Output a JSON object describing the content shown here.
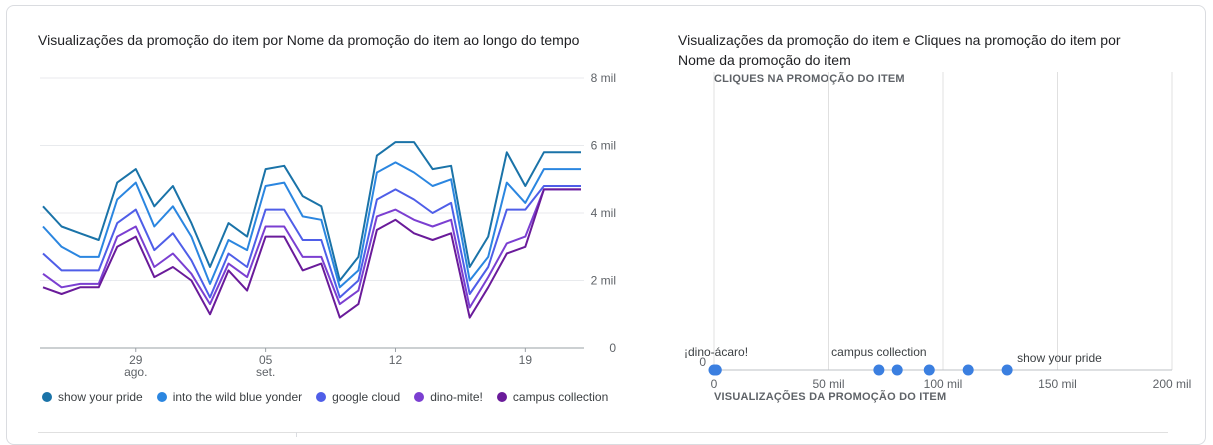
{
  "chart_data": [
    {
      "type": "line",
      "title": "Visualizações da promoção do item por Nome da promoção do item ao longo do tempo",
      "ylim": [
        0,
        8000
      ],
      "y_ticks": [
        "0",
        "2 mil",
        "4 mil",
        "6 mil",
        "8 mil"
      ],
      "y_tick_values": [
        0,
        2000,
        4000,
        6000,
        8000
      ],
      "x_tick_labels": [
        {
          "index": 5,
          "line1": "29",
          "line2": "ago."
        },
        {
          "index": 12,
          "line1": "05",
          "line2": "set."
        },
        {
          "index": 19,
          "line1": "12",
          "line2": ""
        },
        {
          "index": 26,
          "line1": "19",
          "line2": ""
        }
      ],
      "x_count": 30,
      "series": [
        {
          "name": "show your pride",
          "color": "#1a73a8",
          "values": [
            4200,
            3600,
            3400,
            3200,
            4900,
            5300,
            4200,
            4800,
            3700,
            2400,
            3700,
            3300,
            5300,
            5400,
            4500,
            4200,
            2000,
            2700,
            5700,
            6100,
            6100,
            5300,
            5400,
            2400,
            3300,
            5800,
            4800,
            5800,
            5800,
            5800
          ]
        },
        {
          "name": "into the wild blue yonder",
          "color": "#2b86e0",
          "values": [
            3600,
            3000,
            2700,
            2700,
            4400,
            4900,
            3600,
            4200,
            3300,
            1900,
            3200,
            2900,
            4800,
            4900,
            3900,
            3800,
            1800,
            2300,
            5200,
            5500,
            5200,
            4800,
            5000,
            2000,
            2700,
            4900,
            4300,
            5300,
            5300,
            5300
          ]
        },
        {
          "name": "google cloud",
          "color": "#4f5ee8",
          "values": [
            2800,
            2300,
            2300,
            2300,
            3700,
            4100,
            2900,
            3400,
            2600,
            1500,
            2800,
            2400,
            4100,
            4100,
            3200,
            3200,
            1500,
            2000,
            4400,
            4700,
            4400,
            4000,
            4300,
            1600,
            2400,
            4100,
            4100,
            4800,
            4800,
            4800
          ]
        },
        {
          "name": "dino-mite!",
          "color": "#7b3fd1",
          "values": [
            2200,
            1800,
            1900,
            1900,
            3300,
            3600,
            2400,
            2800,
            2200,
            1300,
            2500,
            2100,
            3600,
            3600,
            2700,
            2700,
            1300,
            1700,
            3900,
            4100,
            3800,
            3600,
            3800,
            1200,
            2100,
            3100,
            3300,
            4700,
            4700,
            4700
          ]
        },
        {
          "name": "campus collection",
          "color": "#6a1b9a",
          "values": [
            1800,
            1600,
            1800,
            1800,
            3000,
            3300,
            2100,
            2400,
            2000,
            1000,
            2300,
            1700,
            3300,
            3300,
            2300,
            2500,
            900,
            1300,
            3500,
            3800,
            3400,
            3200,
            3400,
            900,
            1800,
            2800,
            3000,
            4700,
            4700,
            4700
          ]
        }
      ]
    },
    {
      "type": "scatter",
      "title": "Visualizações da promoção do item e Cliques na promoção do item por Nome da promoção do item",
      "xlabel": "VISUALIZAÇÕES DA PROMOÇÃO DO ITEM",
      "ylabel": "CLIQUES NA PROMOÇÃO DO ITEM",
      "xlim": [
        0,
        200000
      ],
      "x_ticks": [
        "0",
        "50 mil",
        "100 mil",
        "150 mil",
        "200 mil"
      ],
      "x_tick_values": [
        0,
        50000,
        100000,
        150000,
        200000
      ],
      "y_ticks": [
        "0"
      ],
      "points": [
        {
          "x": 0,
          "y": 0,
          "label": "¡dino-ácaro!"
        },
        {
          "x": 500,
          "y": 0,
          "label": ""
        },
        {
          "x": 1000,
          "y": 0,
          "label": ""
        },
        {
          "x": 72000,
          "y": 0,
          "label": "campus collection"
        },
        {
          "x": 80000,
          "y": 0,
          "label": ""
        },
        {
          "x": 94000,
          "y": 0,
          "label": ""
        },
        {
          "x": 111000,
          "y": 0,
          "label": ""
        },
        {
          "x": 128000,
          "y": 0,
          "label": "show your pride"
        }
      ],
      "point_color": "#3b7fe0"
    }
  ]
}
